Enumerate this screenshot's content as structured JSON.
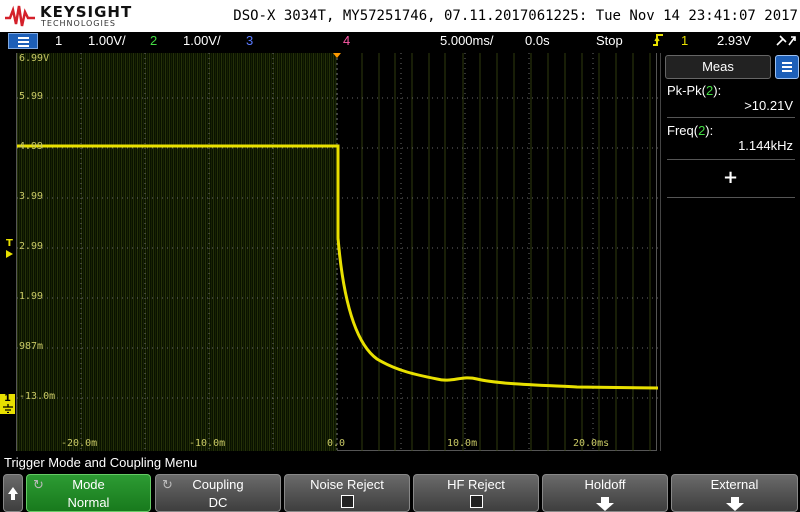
{
  "header": {
    "brand": "KEYSIGHT",
    "brand_sub": "TECHNOLOGIES",
    "title": "DSO-X 3034T, MY57251746, 07.11.2017061225: Tue Nov 14 23:41:07 2017"
  },
  "statusbar": {
    "ch1_label": "1",
    "ch1_scale": "1.00V/",
    "ch2_label": "2",
    "ch2_scale": "1.00V/",
    "ch3_label": "3",
    "ch4_label": "4",
    "timebase": "5.000ms/",
    "delay": "0.0s",
    "run_state": "Stop",
    "trig_icon": "trigger-edge-icon",
    "trig_channel": "1",
    "trig_level": "2.93V",
    "colors": {
      "ch1": "#e8e000",
      "ch2": "#44dd44",
      "ch3": "#5a7aff",
      "ch4": "#ff5aa8",
      "trig": "#e8e000"
    }
  },
  "graticule": {
    "y_labels": [
      "6.99V",
      "5.99",
      "4.99",
      "3.99",
      "2.99",
      "1.99",
      "987m",
      "-13.0m"
    ],
    "x_labels": [
      "-20.0m",
      "-10.0m",
      "0.0",
      "10.0m",
      "20.0ms"
    ],
    "gnd_label": "1",
    "trig_marker": "T"
  },
  "measurements": {
    "tab_label": "Meas",
    "items": [
      {
        "name": "Pk-Pk(",
        "channel": "2",
        "close": "):",
        "value": ">10.21V"
      },
      {
        "name": "Freq(",
        "channel": "2",
        "close": "):",
        "value": "1.144kHz"
      }
    ],
    "add_label": "+"
  },
  "menu": {
    "title": "Trigger Mode and Coupling Menu",
    "softkeys": [
      {
        "label": "Mode",
        "value": "Normal"
      },
      {
        "label": "Coupling",
        "value": "DC"
      },
      {
        "label": "Noise Reject"
      },
      {
        "label": "HF Reject"
      },
      {
        "label": "Holdoff"
      },
      {
        "label": "External"
      }
    ]
  }
}
